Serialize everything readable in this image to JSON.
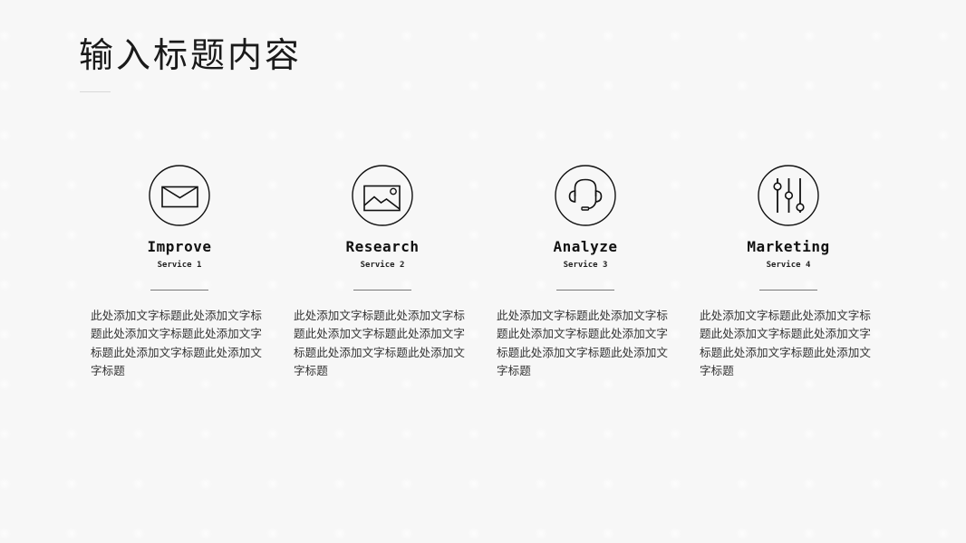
{
  "page": {
    "title": "输入标题内容"
  },
  "services": [
    {
      "icon": "mail-icon",
      "name": "Improve",
      "subtitle": "Service 1",
      "description": "此处添加文字标题此处添加文字标题此处添加文字标题此处添加文字标题此处添加文字标题此处添加文字标题"
    },
    {
      "icon": "image-icon",
      "name": "Research",
      "subtitle": "Service 2",
      "description": "此处添加文字标题此处添加文字标题此处添加文字标题此处添加文字标题此处添加文字标题此处添加文字标题"
    },
    {
      "icon": "headset-icon",
      "name": "Analyze",
      "subtitle": "Service 3",
      "description": "此处添加文字标题此处添加文字标题此处添加文字标题此处添加文字标题此处添加文字标题此处添加文字标题"
    },
    {
      "icon": "sliders-icon",
      "name": "Marketing",
      "subtitle": "Service 4",
      "description": "此处添加文字标题此处添加文字标题此处添加文字标题此处添加文字标题此处添加文字标题此处添加文字标题"
    }
  ]
}
